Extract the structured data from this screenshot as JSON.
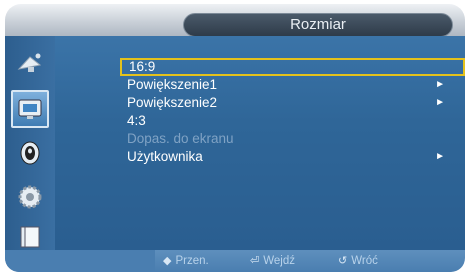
{
  "header": {
    "title": "Rozmiar"
  },
  "sidebar": {
    "items": [
      {
        "icon": "satellite-dish-icon"
      },
      {
        "icon": "picture-icon"
      },
      {
        "icon": "speaker-icon"
      },
      {
        "icon": "gear-icon"
      },
      {
        "icon": "book-icon"
      }
    ],
    "active_index": 1
  },
  "menu": {
    "items": [
      {
        "label": "16:9",
        "arrow": ""
      },
      {
        "label": "Powiększenie1",
        "arrow": "►"
      },
      {
        "label": "Powiększenie2",
        "arrow": "►"
      },
      {
        "label": "4:3",
        "arrow": ""
      },
      {
        "label": "Dopas. do ekranu",
        "arrow": ""
      },
      {
        "label": "Użytkownika",
        "arrow": "►"
      }
    ],
    "selected_index": 0,
    "disabled_index": 4
  },
  "footer": {
    "move_icon": "◆",
    "move_label": "Przen.",
    "enter_icon": "⏎",
    "enter_label": "Wejdź",
    "return_icon": "↺",
    "return_label": "Wróć"
  },
  "colors": {
    "panel": "#2f6698",
    "selection_border": "#e4c21c",
    "disabled_text": "#7fa2c4"
  }
}
